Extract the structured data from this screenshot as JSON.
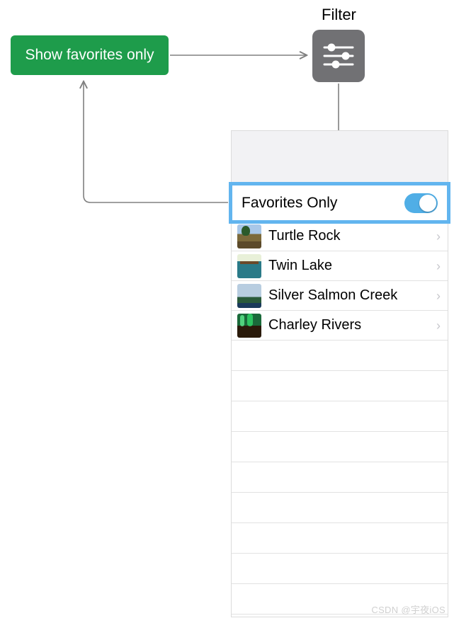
{
  "callout": {
    "label": "Show favorites only"
  },
  "filter": {
    "label": "Filter"
  },
  "panel": {
    "favorites_row": {
      "label": "Favorites Only",
      "on": true
    },
    "items": [
      {
        "name": "Turtle Rock"
      },
      {
        "name": "Twin Lake"
      },
      {
        "name": "Silver Salmon Creek"
      },
      {
        "name": "Charley Rivers"
      }
    ]
  },
  "watermark": "CSDN @宇夜iOS"
}
